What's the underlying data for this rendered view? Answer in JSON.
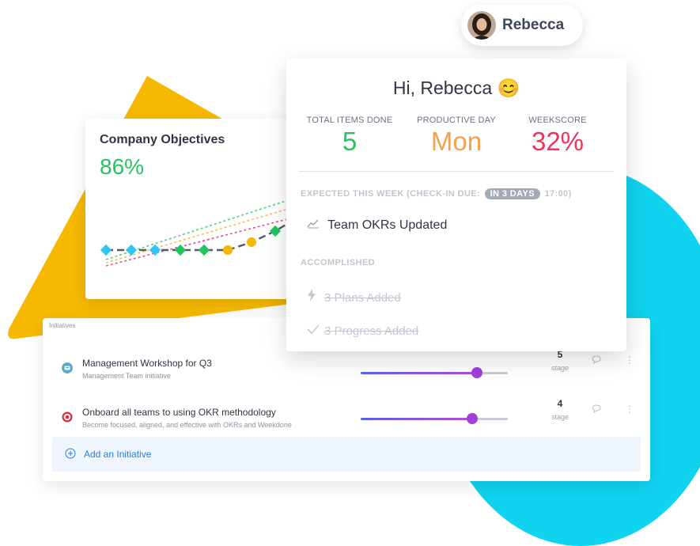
{
  "user": {
    "name": "Rebecca"
  },
  "popup": {
    "greeting": "Hi, Rebecca",
    "greeting_emoji": "😊",
    "stats": [
      {
        "label": "TOTAL ITEMS DONE",
        "value": "5",
        "color": "#22c55e"
      },
      {
        "label": "PRODUCTIVE DAY",
        "value": "Mon",
        "color": "#f5a04a"
      },
      {
        "label": "WEEKSCORE",
        "value": "32%",
        "color": "#f0325a"
      }
    ],
    "expected": {
      "prefix": "EXPECTED THIS WEEK (CHECK-IN DUE:",
      "badge": "IN 3 DAYS",
      "suffix": "17:00)"
    },
    "expected_item": {
      "icon": "trend-chart-icon",
      "label": "Team OKRs Updated"
    },
    "accomplished_heading": "ACCOMPLISHED",
    "accomplished": [
      {
        "icon": "lightning-icon",
        "label": "3 Plans Added"
      },
      {
        "icon": "checkmark-icon",
        "label": "3 Progress Added"
      }
    ]
  },
  "objectives": {
    "title": "Company Objectives",
    "percent": "86%",
    "accent": "#22c55e"
  },
  "initiatives": {
    "header": "Initiatives",
    "stage_label": "stage",
    "rows": [
      {
        "title": "Management Workshop for Q3",
        "subtitle": "Management Team initiative",
        "stage": "5",
        "progress": 0.79,
        "icon": "management-icon"
      },
      {
        "title": "Onboard all teams to using OKR methodology",
        "subtitle": "Become focused, aligned, and effective with OKRs and Weekdone",
        "stage": "4",
        "progress": 0.76,
        "icon": "target-icon"
      }
    ],
    "add_label": "Add an Initiative"
  },
  "colors": {
    "yellow": "#f7b900",
    "cyan": "#10d3ef",
    "blue_link": "#2a7de1"
  }
}
